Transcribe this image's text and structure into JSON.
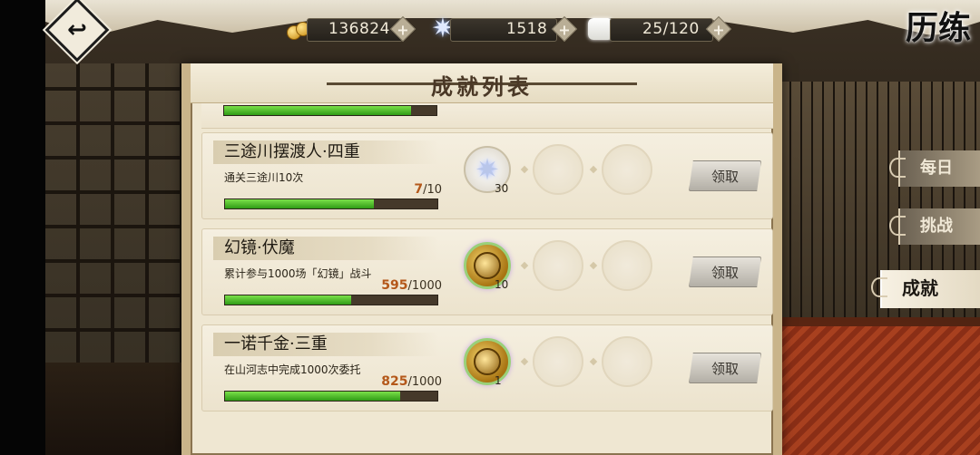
{
  "page_title": "历练",
  "currency": {
    "coins": "136824",
    "jade": "1518",
    "stamina": "25/120",
    "plus": "+"
  },
  "panel": {
    "title": "成就列表"
  },
  "tabs": {
    "daily": "每日",
    "challenge": "挑战",
    "achievement": "成就"
  },
  "achievements": [
    {
      "title": "三途川摆渡人·四重",
      "desc": "通关三途川10次",
      "progress_current": "7",
      "progress_total": "/10",
      "progress_fraction": 0.7,
      "reward_icon": "jade-star-icon",
      "reward_count": "30",
      "claim_label": "领取"
    },
    {
      "title": "幻镜·伏魔",
      "desc": "累计参与1000场「幻镜」战斗",
      "progress_current": "595",
      "progress_total": "/1000",
      "progress_fraction": 0.595,
      "reward_icon": "medal-icon",
      "reward_count": "10",
      "claim_label": "领取"
    },
    {
      "title": "一诺千金·三重",
      "desc": "在山河志中完成1000次委托",
      "progress_current": "825",
      "progress_total": "/1000",
      "progress_fraction": 0.825,
      "reward_icon": "medal-icon",
      "reward_count": "1",
      "claim_label": "领取"
    }
  ],
  "partial_row_progress_fraction": 0.88
}
